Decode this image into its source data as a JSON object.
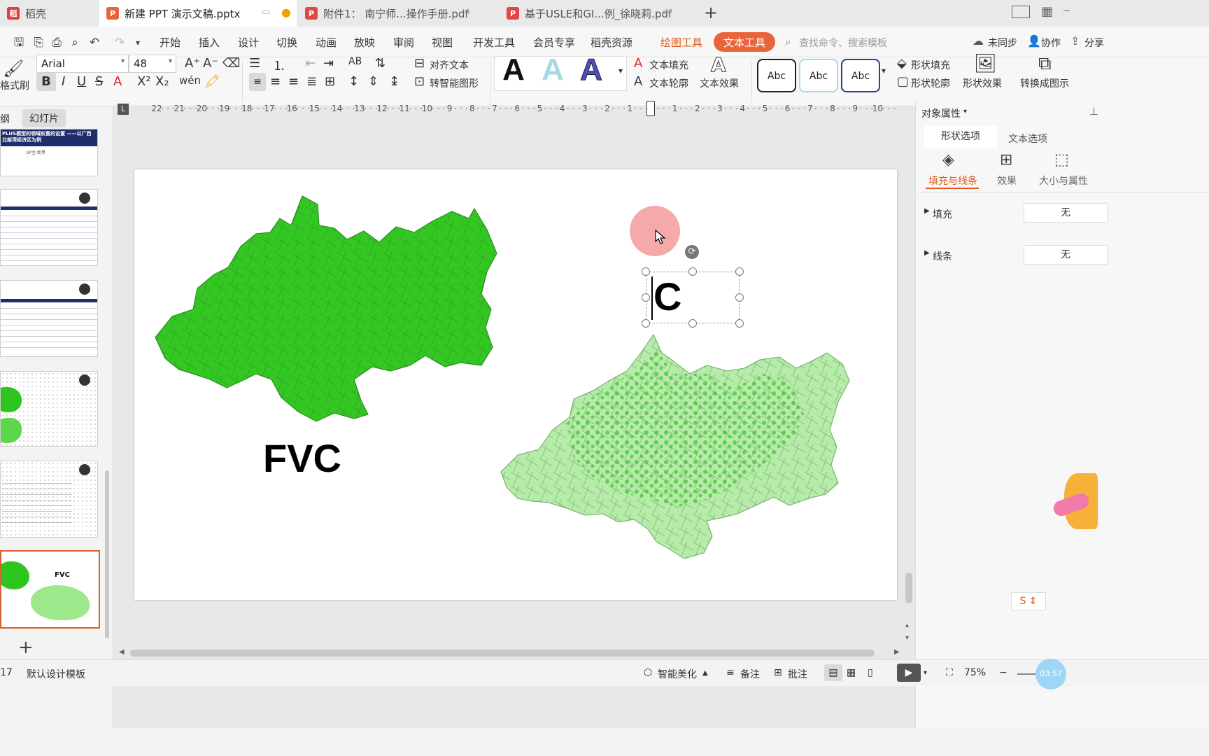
{
  "tabs": [
    {
      "label": "稻壳",
      "icon": "docer-icon"
    },
    {
      "label": "新建 PPT 演示文稿.pptx",
      "icon": "ppt-icon"
    },
    {
      "label": "附件1： 南宁师...操作手册.pdf",
      "icon": "pdf-icon"
    },
    {
      "label": "基于USLE和GI...例_徐晓莉.pdf",
      "icon": "pdf-icon"
    }
  ],
  "tab_new": "+",
  "menu": {
    "items": [
      "开始",
      "插入",
      "设计",
      "切换",
      "动画",
      "放映",
      "审阅",
      "视图",
      "开发工具",
      "会员专享",
      "稻壳资源"
    ],
    "drawing_tools": "绘图工具",
    "text_tools": "文本工具",
    "search_placeholder": "查找命令、搜索模板",
    "sync": "未同步",
    "collab": "协作",
    "share": "分享"
  },
  "ribbon": {
    "format_painter": "格式刷",
    "font_name": "Arial",
    "font_size": "48",
    "align_text": "对齐文本",
    "smartart": "转智能图形",
    "text_fill": "文本填充",
    "text_outline": "文本轮廓",
    "text_effect": "文本效果",
    "shape_fill": "形状填充",
    "shape_outline": "形状轮廓",
    "shape_effect": "形状效果",
    "convert": "转换成图示",
    "wordart_letter": "A",
    "abc": "Abc"
  },
  "left_panel": {
    "tab_outline": "大纲",
    "tab_slides": "幻灯片",
    "thumb1_title": "PLUS模型的领域权重的设置 ——以广西北部湾经济区为例",
    "thumb1_sub": "UP主:新黑",
    "thumb6_title": "FVC",
    "add_button": "+"
  },
  "ruler": {
    "labels": [
      "22",
      "21",
      "20",
      "19",
      "18",
      "17",
      "16",
      "15",
      "14",
      "13",
      "12",
      "11",
      "10",
      "9",
      "8",
      "7",
      "6",
      "5",
      "4",
      "3",
      "2",
      "1",
      "0",
      "1",
      "2",
      "3",
      "4",
      "5",
      "6",
      "7",
      "8",
      "9",
      "10"
    ]
  },
  "slide": {
    "fvc_label": "FVC",
    "textbox_text": "C"
  },
  "right_panel": {
    "title": "对象属性",
    "tab_shape": "形状选项",
    "tab_text": "文本选项",
    "sub_fill_line": "填充与线条",
    "sub_effect": "效果",
    "sub_size": "大小与属性",
    "fill_label": "填充",
    "fill_value": "无",
    "line_label": "线条",
    "line_value": "无"
  },
  "status": {
    "slide_num": "17",
    "template": "默认设计模板",
    "beautify": "智能美化",
    "notes": "备注",
    "comments": "批注",
    "zoom": "75%",
    "timer": "03:57"
  },
  "colors": {
    "accent": "#e8643a",
    "map_dark": "#33cc22",
    "map_light": "#aee8a0",
    "cursor_circle": "#f4a0a0"
  }
}
